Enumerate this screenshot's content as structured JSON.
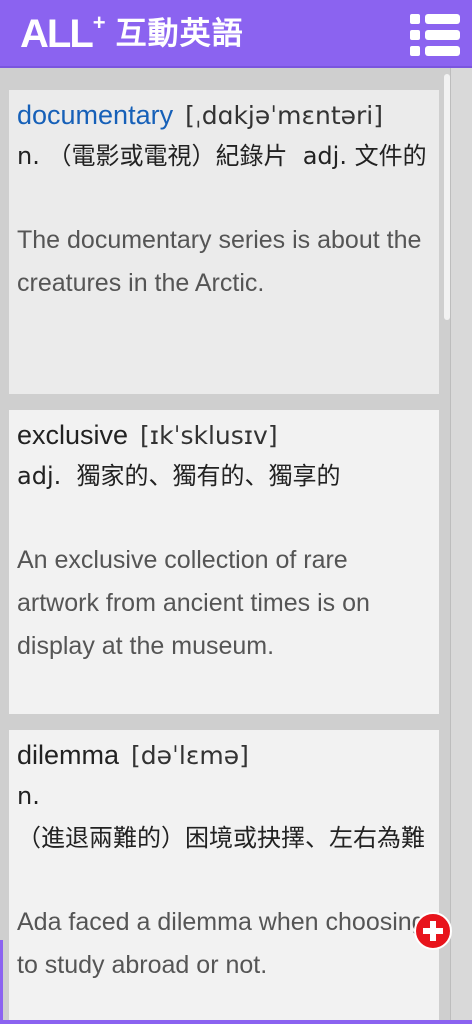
{
  "header": {
    "logo_text": "ALL",
    "logo_plus": "+",
    "logo_cn": "互動英語",
    "menu_icon": "list-menu-icon"
  },
  "colors": {
    "brand": "#8b63f0",
    "word_link": "#1660b8",
    "add_button": "#e8141c"
  },
  "entries": [
    {
      "word": "documentary",
      "phonetic": "[ˌdɑkjəˈmɛntəri]",
      "definition": "n. （電影或電視）紀錄片  adj. 文件的",
      "example": "The documentary series is about the creatures in the Arctic."
    },
    {
      "word": "exclusive",
      "phonetic": "[ɪkˈsklusɪv]",
      "definition": "adj.  獨家的、獨有的、獨享的",
      "example": "An exclusive collection of rare artwork from ancient times is on display at the museum."
    },
    {
      "word": "dilemma",
      "phonetic": "[dəˈlɛmə]",
      "definition": "n.\n（進退兩難的）困境或抉擇、左右為難",
      "example": "Ada faced a dilemma when choosing to study abroad or not."
    }
  ],
  "fab_icon": "add-plus-icon"
}
